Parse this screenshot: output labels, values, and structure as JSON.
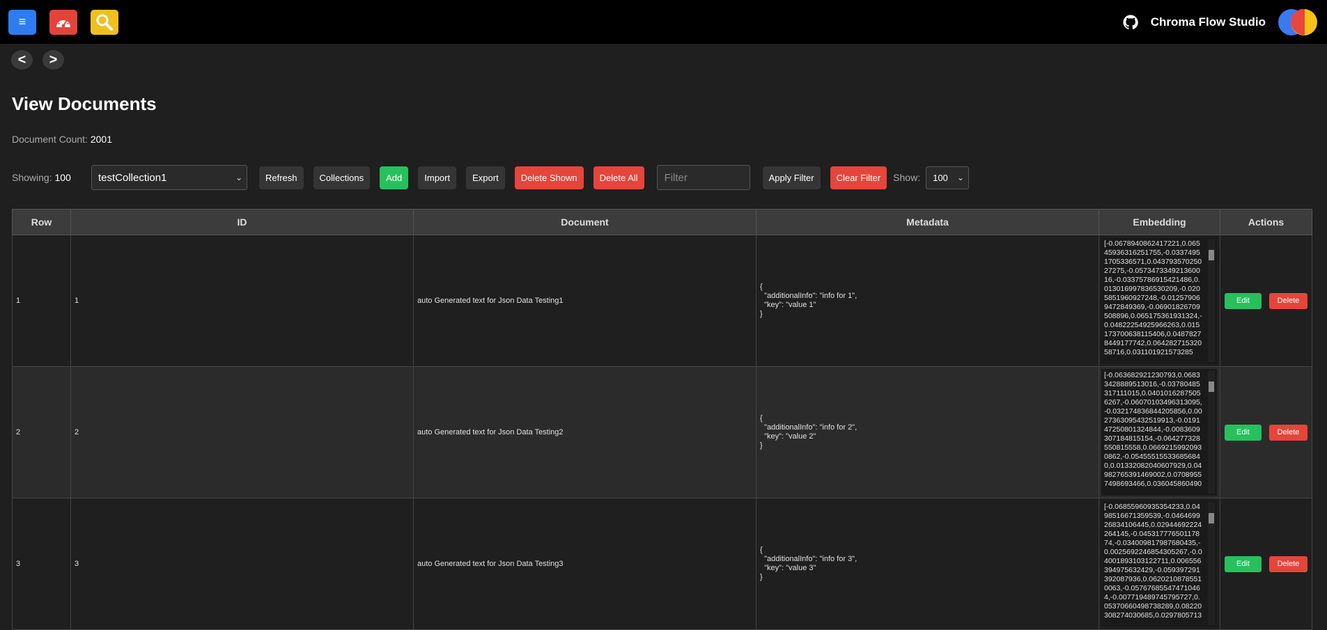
{
  "header": {
    "menu_icon": "≡",
    "dashboard_icon": "gauge-icon",
    "search_icon": "search-icon",
    "brand_title": "Chroma Flow Studio",
    "github_icon": "github-icon"
  },
  "nav": {
    "back": "<",
    "forward": ">"
  },
  "page": {
    "title": "View Documents",
    "doc_count_label": "Document Count:",
    "doc_count": "2001"
  },
  "toolbar": {
    "showing_label": "Showing:",
    "showing_value": "100",
    "collection_selected": "testCollection1",
    "refresh": "Refresh",
    "collections": "Collections",
    "add": "Add",
    "import": "Import",
    "export": "Export",
    "delete_shown": "Delete Shown",
    "delete_all": "Delete All",
    "filter_placeholder": "Filter",
    "apply_filter": "Apply Filter",
    "clear_filter": "Clear Filter",
    "show_label": "Show:",
    "show_value": "100"
  },
  "colors": {
    "green": "#27c05d",
    "red": "#e5453b",
    "blue": "#2f7cf0",
    "yellow": "#f0c020"
  },
  "table": {
    "headers": [
      "Row",
      "ID",
      "Document",
      "Metadata",
      "Embedding",
      "Actions"
    ],
    "edit_label": "Edit",
    "delete_label": "Delete",
    "rows": [
      {
        "row": "1",
        "id": "1",
        "document": "auto Generated text for Json Data Testing1",
        "metadata": "{\n  \"additionalInfo\": \"info for 1\",\n  \"key\": \"value 1\"\n}",
        "embedding": "[-0.0678940862417221,0.06545936316251755,-0.03374951705336571,0.04379357025027275,-0.057347334921360016,-0.03375786915421486,0.013016997836530209,-0.0205851960927248,-0.012579069472849369,-0.06901826709508896,0.065175361931324,-0.04822254925966263,0.015173700638115406,0.04878278449177742,0.06428271532058716,0.031101921573285"
      },
      {
        "row": "2",
        "id": "2",
        "document": "auto Generated text for Json Data Testing2",
        "metadata": "{\n  \"additionalInfo\": \"info for 2\",\n  \"key\": \"value 2\"\n}",
        "embedding": "[-0.063682921230793,0.06833428889513016,-0.03780485317111015,0.04010162875056267,-0.06070103496313095,-0.032174836844205856,0.0027363095432519913,-0.019147250801324844,-0.0083609307184815154,-0.064277328550815558,0.06692159920930862,-0.054555155336856840,0.01332082040607929,0.04982765391469002,0.07089557498693466,0.036045860490"
      },
      {
        "row": "3",
        "id": "3",
        "document": "auto Generated text for Json Data Testing3",
        "metadata": "{\n  \"additionalInfo\": \"info for 3\",\n  \"key\": \"value 3\"\n}",
        "embedding": "[-0.06855960935354233,0.0498516671359539,-0.046469926834106445,0.02944692224264145,-0.04531777650117874,-0.034009817987680435,-0.0025692246854305267,-0.04001893103122711,0.006556394975632429,-0.059397291392087936,0.06202108785510063,-0.057676855474710464,-0.007719489745795727,0.05370660498738289,0.08220308274030685,0.0297805713"
      }
    ]
  }
}
